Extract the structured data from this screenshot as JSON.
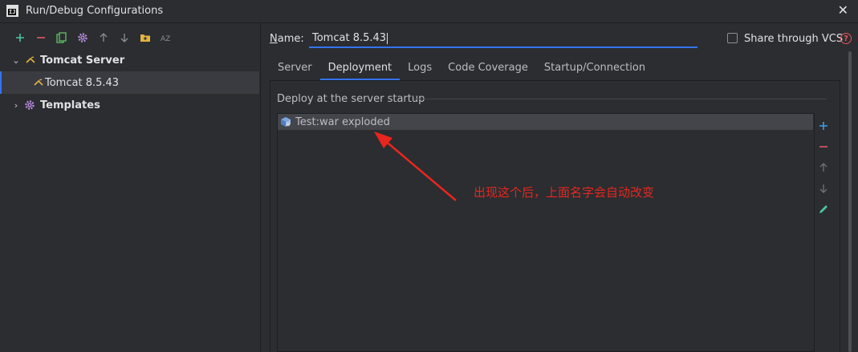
{
  "window": {
    "title": "Run/Debug Configurations",
    "logo_text": "IJ"
  },
  "left_toolbar": {
    "icons": [
      "add-icon",
      "remove-icon",
      "copy-icon",
      "settings-icon",
      "move-up-icon",
      "move-down-icon",
      "folder-icon",
      "sort-az-icon"
    ]
  },
  "tree": {
    "server_group": "Tomcat Server",
    "server_item": "Tomcat 8.5.43",
    "templates": "Templates"
  },
  "form": {
    "name_label_prefix": "N",
    "name_label_rest": "ame:",
    "name_value": "Tomcat 8.5.43",
    "share_label": "Share through VCS",
    "share_checked": false
  },
  "tabs": [
    {
      "label": "Server",
      "active": false
    },
    {
      "label": "Deployment",
      "active": true
    },
    {
      "label": "Logs",
      "active": false
    },
    {
      "label": "Code Coverage",
      "active": false
    },
    {
      "label": "Startup/Connection",
      "active": false
    }
  ],
  "deployment": {
    "section_title": "Deploy at the server startup",
    "items": [
      "Test:war exploded"
    ]
  },
  "annotation": {
    "text": "出现这个后，上面名字会自动改变",
    "color": "#e8261e"
  },
  "colors": {
    "accent": "#3574f0",
    "background": "#2b2d30",
    "selection": "#393b40"
  }
}
